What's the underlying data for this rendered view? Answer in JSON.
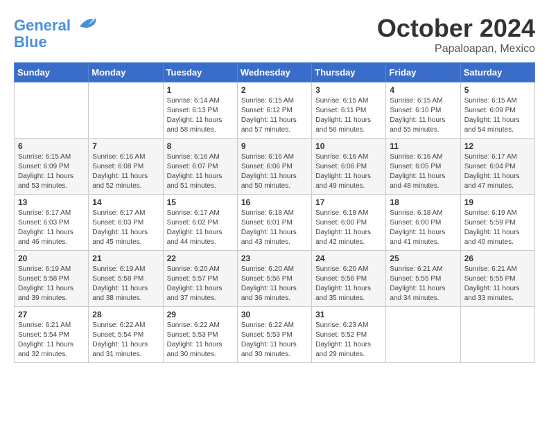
{
  "header": {
    "logo_line1": "General",
    "logo_line2": "Blue",
    "month": "October 2024",
    "location": "Papaloapan, Mexico"
  },
  "weekdays": [
    "Sunday",
    "Monday",
    "Tuesday",
    "Wednesday",
    "Thursday",
    "Friday",
    "Saturday"
  ],
  "weeks": [
    [
      {
        "day": "",
        "content": ""
      },
      {
        "day": "",
        "content": ""
      },
      {
        "day": "1",
        "content": "Sunrise: 6:14 AM\nSunset: 6:13 PM\nDaylight: 11 hours and 58 minutes."
      },
      {
        "day": "2",
        "content": "Sunrise: 6:15 AM\nSunset: 6:12 PM\nDaylight: 11 hours and 57 minutes."
      },
      {
        "day": "3",
        "content": "Sunrise: 6:15 AM\nSunset: 6:11 PM\nDaylight: 11 hours and 56 minutes."
      },
      {
        "day": "4",
        "content": "Sunrise: 6:15 AM\nSunset: 6:10 PM\nDaylight: 11 hours and 55 minutes."
      },
      {
        "day": "5",
        "content": "Sunrise: 6:15 AM\nSunset: 6:09 PM\nDaylight: 11 hours and 54 minutes."
      }
    ],
    [
      {
        "day": "6",
        "content": "Sunrise: 6:15 AM\nSunset: 6:09 PM\nDaylight: 11 hours and 53 minutes."
      },
      {
        "day": "7",
        "content": "Sunrise: 6:16 AM\nSunset: 6:08 PM\nDaylight: 11 hours and 52 minutes."
      },
      {
        "day": "8",
        "content": "Sunrise: 6:16 AM\nSunset: 6:07 PM\nDaylight: 11 hours and 51 minutes."
      },
      {
        "day": "9",
        "content": "Sunrise: 6:16 AM\nSunset: 6:06 PM\nDaylight: 11 hours and 50 minutes."
      },
      {
        "day": "10",
        "content": "Sunrise: 6:16 AM\nSunset: 6:06 PM\nDaylight: 11 hours and 49 minutes."
      },
      {
        "day": "11",
        "content": "Sunrise: 6:16 AM\nSunset: 6:05 PM\nDaylight: 11 hours and 48 minutes."
      },
      {
        "day": "12",
        "content": "Sunrise: 6:17 AM\nSunset: 6:04 PM\nDaylight: 11 hours and 47 minutes."
      }
    ],
    [
      {
        "day": "13",
        "content": "Sunrise: 6:17 AM\nSunset: 6:03 PM\nDaylight: 11 hours and 46 minutes."
      },
      {
        "day": "14",
        "content": "Sunrise: 6:17 AM\nSunset: 6:03 PM\nDaylight: 11 hours and 45 minutes."
      },
      {
        "day": "15",
        "content": "Sunrise: 6:17 AM\nSunset: 6:02 PM\nDaylight: 11 hours and 44 minutes."
      },
      {
        "day": "16",
        "content": "Sunrise: 6:18 AM\nSunset: 6:01 PM\nDaylight: 11 hours and 43 minutes."
      },
      {
        "day": "17",
        "content": "Sunrise: 6:18 AM\nSunset: 6:00 PM\nDaylight: 11 hours and 42 minutes."
      },
      {
        "day": "18",
        "content": "Sunrise: 6:18 AM\nSunset: 6:00 PM\nDaylight: 11 hours and 41 minutes."
      },
      {
        "day": "19",
        "content": "Sunrise: 6:19 AM\nSunset: 5:59 PM\nDaylight: 11 hours and 40 minutes."
      }
    ],
    [
      {
        "day": "20",
        "content": "Sunrise: 6:19 AM\nSunset: 5:58 PM\nDaylight: 11 hours and 39 minutes."
      },
      {
        "day": "21",
        "content": "Sunrise: 6:19 AM\nSunset: 5:58 PM\nDaylight: 11 hours and 38 minutes."
      },
      {
        "day": "22",
        "content": "Sunrise: 6:20 AM\nSunset: 5:57 PM\nDaylight: 11 hours and 37 minutes."
      },
      {
        "day": "23",
        "content": "Sunrise: 6:20 AM\nSunset: 5:56 PM\nDaylight: 11 hours and 36 minutes."
      },
      {
        "day": "24",
        "content": "Sunrise: 6:20 AM\nSunset: 5:56 PM\nDaylight: 11 hours and 35 minutes."
      },
      {
        "day": "25",
        "content": "Sunrise: 6:21 AM\nSunset: 5:55 PM\nDaylight: 11 hours and 34 minutes."
      },
      {
        "day": "26",
        "content": "Sunrise: 6:21 AM\nSunset: 5:55 PM\nDaylight: 11 hours and 33 minutes."
      }
    ],
    [
      {
        "day": "27",
        "content": "Sunrise: 6:21 AM\nSunset: 5:54 PM\nDaylight: 11 hours and 32 minutes."
      },
      {
        "day": "28",
        "content": "Sunrise: 6:22 AM\nSunset: 5:54 PM\nDaylight: 11 hours and 31 minutes."
      },
      {
        "day": "29",
        "content": "Sunrise: 6:22 AM\nSunset: 5:53 PM\nDaylight: 11 hours and 30 minutes."
      },
      {
        "day": "30",
        "content": "Sunrise: 6:22 AM\nSunset: 5:53 PM\nDaylight: 11 hours and 30 minutes."
      },
      {
        "day": "31",
        "content": "Sunrise: 6:23 AM\nSunset: 5:52 PM\nDaylight: 11 hours and 29 minutes."
      },
      {
        "day": "",
        "content": ""
      },
      {
        "day": "",
        "content": ""
      }
    ]
  ]
}
